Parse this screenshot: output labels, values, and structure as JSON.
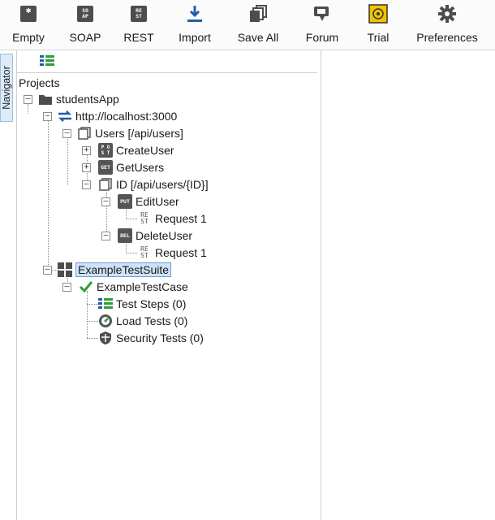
{
  "toolbar": {
    "buttons": [
      {
        "label": "Empty",
        "icon": "empty-project-icon"
      },
      {
        "label": "SOAP",
        "icon": "soap-project-icon",
        "badge": "SO AP"
      },
      {
        "label": "REST",
        "icon": "rest-project-icon",
        "badge": "RE ST"
      },
      {
        "label": "Import",
        "icon": "import-icon"
      },
      {
        "label": "Save All",
        "icon": "save-all-icon"
      },
      {
        "label": "Forum",
        "icon": "forum-icon"
      },
      {
        "label": "Trial",
        "icon": "trial-icon"
      },
      {
        "label": "Preferences",
        "icon": "gear-icon"
      }
    ]
  },
  "navigator": {
    "tab_label": "Navigator"
  },
  "tree": {
    "root_label": "Projects",
    "project": "studentsApp",
    "service": "http://localhost:3000",
    "resource": "Users [/api/users]",
    "create_user": {
      "method": "POST",
      "label": "CreateUser"
    },
    "get_users": {
      "method": "GET",
      "label": "GetUsers"
    },
    "id_resource": "ID [/api/users/{ID}]",
    "edit_user": {
      "method": "PUT",
      "label": "EditUser"
    },
    "edit_request": "Request 1",
    "delete_user": {
      "method": "DEL",
      "label": "DeleteUser"
    },
    "delete_request": "Request 1",
    "suite": "ExampleTestSuite",
    "test_case": "ExampleTestCase",
    "test_steps": "Test Steps (0)",
    "load_tests": "Load Tests (0)",
    "security_tests": "Security Tests (0)",
    "rest_badge": "RE ST"
  },
  "colors": {
    "accent_blue": "#1f5fa8",
    "selection_bg": "#cfe2f7",
    "check_green": "#2e9e3a",
    "trial_yellow": "#f2c200"
  }
}
